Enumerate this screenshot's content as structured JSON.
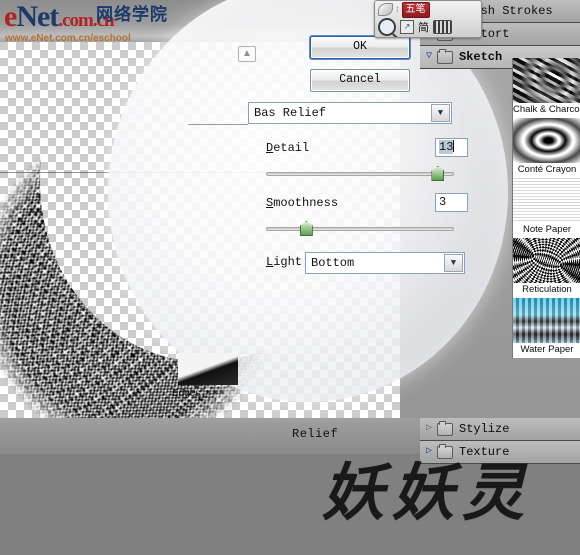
{
  "logo": {
    "brand_e": "e",
    "brand_net": "Net",
    "brand_cjk": "网络学院",
    "brand_tld": ".com.cn",
    "url": "www.eNet.com.cn/eschool",
    "color_red": "#b22222",
    "color_navy": "#1b3a6b",
    "color_url": "#b5651d"
  },
  "ime": {
    "pen_icon": "pen-icon",
    "dots_icon": "dots-icon",
    "badge": "五笔",
    "magnifier_icon": "magnifier-icon",
    "box_icon": "box-icon",
    "mode": "简",
    "keyboard_icon": "keyboard-icon"
  },
  "dialog": {
    "ok_label": "OK",
    "cancel_label": "Cancel",
    "filter_select": "Bas Relief",
    "chevron_icon": "chevron-down-icon",
    "collapse_icon": "chevron-up-icon",
    "detail": {
      "label": "Detail",
      "value": "13",
      "slider_percent": 88
    },
    "smoothness": {
      "label": "Smoothness",
      "value": "3",
      "slider_percent": 18
    },
    "light": {
      "label": "Light:",
      "value": "Bottom"
    }
  },
  "canvas": {
    "relief_label": "Relief",
    "torn_edges_caption": "Edges"
  },
  "sidebar": {
    "tree": [
      {
        "label": "Brush Strokes",
        "expanded": false,
        "selected": false,
        "triangle": "▶"
      },
      {
        "label": "Distort",
        "expanded": false,
        "selected": false,
        "triangle": "▶"
      },
      {
        "label": "Sketch",
        "expanded": true,
        "selected": true,
        "triangle": "▽"
      },
      {
        "label": "Stylize",
        "expanded": false,
        "selected": false,
        "triangle": "▷"
      },
      {
        "label": "Texture",
        "expanded": false,
        "selected": false,
        "triangle": "▷"
      }
    ],
    "thumbnails": [
      {
        "caption": "Chalk & Charcoal",
        "swatch": "t-chalk"
      },
      {
        "caption": "Conté Crayon",
        "swatch": "t-conte"
      },
      {
        "caption": "Note Paper",
        "swatch": "t-note"
      },
      {
        "caption": "Reticulation",
        "swatch": "t-retic"
      },
      {
        "caption": "Water Paper",
        "swatch": "t-water"
      }
    ]
  },
  "watermark": {
    "text": "妖妖灵"
  }
}
